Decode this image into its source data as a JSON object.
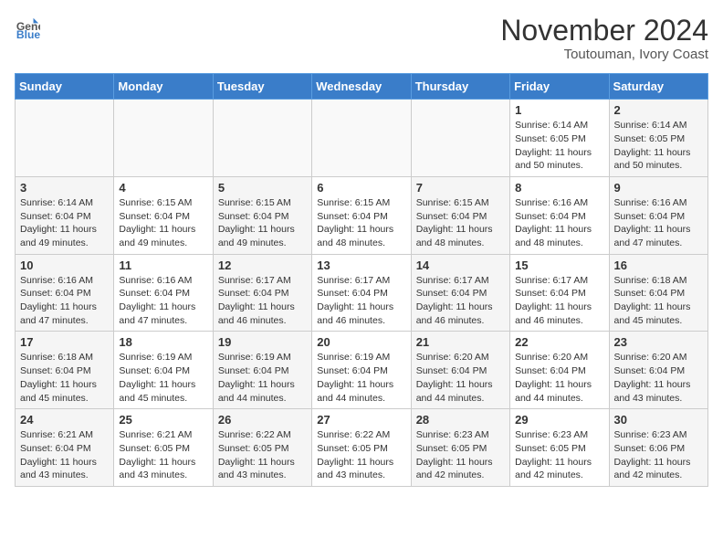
{
  "logo": {
    "line1": "General",
    "line2": "Blue"
  },
  "title": "November 2024",
  "subtitle": "Toutouman, Ivory Coast",
  "days_of_week": [
    "Sunday",
    "Monday",
    "Tuesday",
    "Wednesday",
    "Thursday",
    "Friday",
    "Saturday"
  ],
  "weeks": [
    [
      {
        "day": "",
        "info": ""
      },
      {
        "day": "",
        "info": ""
      },
      {
        "day": "",
        "info": ""
      },
      {
        "day": "",
        "info": ""
      },
      {
        "day": "",
        "info": ""
      },
      {
        "day": "1",
        "info": "Sunrise: 6:14 AM\nSunset: 6:05 PM\nDaylight: 11 hours\nand 50 minutes."
      },
      {
        "day": "2",
        "info": "Sunrise: 6:14 AM\nSunset: 6:05 PM\nDaylight: 11 hours\nand 50 minutes."
      }
    ],
    [
      {
        "day": "3",
        "info": "Sunrise: 6:14 AM\nSunset: 6:04 PM\nDaylight: 11 hours\nand 49 minutes."
      },
      {
        "day": "4",
        "info": "Sunrise: 6:15 AM\nSunset: 6:04 PM\nDaylight: 11 hours\nand 49 minutes."
      },
      {
        "day": "5",
        "info": "Sunrise: 6:15 AM\nSunset: 6:04 PM\nDaylight: 11 hours\nand 49 minutes."
      },
      {
        "day": "6",
        "info": "Sunrise: 6:15 AM\nSunset: 6:04 PM\nDaylight: 11 hours\nand 48 minutes."
      },
      {
        "day": "7",
        "info": "Sunrise: 6:15 AM\nSunset: 6:04 PM\nDaylight: 11 hours\nand 48 minutes."
      },
      {
        "day": "8",
        "info": "Sunrise: 6:16 AM\nSunset: 6:04 PM\nDaylight: 11 hours\nand 48 minutes."
      },
      {
        "day": "9",
        "info": "Sunrise: 6:16 AM\nSunset: 6:04 PM\nDaylight: 11 hours\nand 47 minutes."
      }
    ],
    [
      {
        "day": "10",
        "info": "Sunrise: 6:16 AM\nSunset: 6:04 PM\nDaylight: 11 hours\nand 47 minutes."
      },
      {
        "day": "11",
        "info": "Sunrise: 6:16 AM\nSunset: 6:04 PM\nDaylight: 11 hours\nand 47 minutes."
      },
      {
        "day": "12",
        "info": "Sunrise: 6:17 AM\nSunset: 6:04 PM\nDaylight: 11 hours\nand 46 minutes."
      },
      {
        "day": "13",
        "info": "Sunrise: 6:17 AM\nSunset: 6:04 PM\nDaylight: 11 hours\nand 46 minutes."
      },
      {
        "day": "14",
        "info": "Sunrise: 6:17 AM\nSunset: 6:04 PM\nDaylight: 11 hours\nand 46 minutes."
      },
      {
        "day": "15",
        "info": "Sunrise: 6:17 AM\nSunset: 6:04 PM\nDaylight: 11 hours\nand 46 minutes."
      },
      {
        "day": "16",
        "info": "Sunrise: 6:18 AM\nSunset: 6:04 PM\nDaylight: 11 hours\nand 45 minutes."
      }
    ],
    [
      {
        "day": "17",
        "info": "Sunrise: 6:18 AM\nSunset: 6:04 PM\nDaylight: 11 hours\nand 45 minutes."
      },
      {
        "day": "18",
        "info": "Sunrise: 6:19 AM\nSunset: 6:04 PM\nDaylight: 11 hours\nand 45 minutes."
      },
      {
        "day": "19",
        "info": "Sunrise: 6:19 AM\nSunset: 6:04 PM\nDaylight: 11 hours\nand 44 minutes."
      },
      {
        "day": "20",
        "info": "Sunrise: 6:19 AM\nSunset: 6:04 PM\nDaylight: 11 hours\nand 44 minutes."
      },
      {
        "day": "21",
        "info": "Sunrise: 6:20 AM\nSunset: 6:04 PM\nDaylight: 11 hours\nand 44 minutes."
      },
      {
        "day": "22",
        "info": "Sunrise: 6:20 AM\nSunset: 6:04 PM\nDaylight: 11 hours\nand 44 minutes."
      },
      {
        "day": "23",
        "info": "Sunrise: 6:20 AM\nSunset: 6:04 PM\nDaylight: 11 hours\nand 43 minutes."
      }
    ],
    [
      {
        "day": "24",
        "info": "Sunrise: 6:21 AM\nSunset: 6:04 PM\nDaylight: 11 hours\nand 43 minutes."
      },
      {
        "day": "25",
        "info": "Sunrise: 6:21 AM\nSunset: 6:05 PM\nDaylight: 11 hours\nand 43 minutes."
      },
      {
        "day": "26",
        "info": "Sunrise: 6:22 AM\nSunset: 6:05 PM\nDaylight: 11 hours\nand 43 minutes."
      },
      {
        "day": "27",
        "info": "Sunrise: 6:22 AM\nSunset: 6:05 PM\nDaylight: 11 hours\nand 43 minutes."
      },
      {
        "day": "28",
        "info": "Sunrise: 6:23 AM\nSunset: 6:05 PM\nDaylight: 11 hours\nand 42 minutes."
      },
      {
        "day": "29",
        "info": "Sunrise: 6:23 AM\nSunset: 6:05 PM\nDaylight: 11 hours\nand 42 minutes."
      },
      {
        "day": "30",
        "info": "Sunrise: 6:23 AM\nSunset: 6:06 PM\nDaylight: 11 hours\nand 42 minutes."
      }
    ]
  ]
}
